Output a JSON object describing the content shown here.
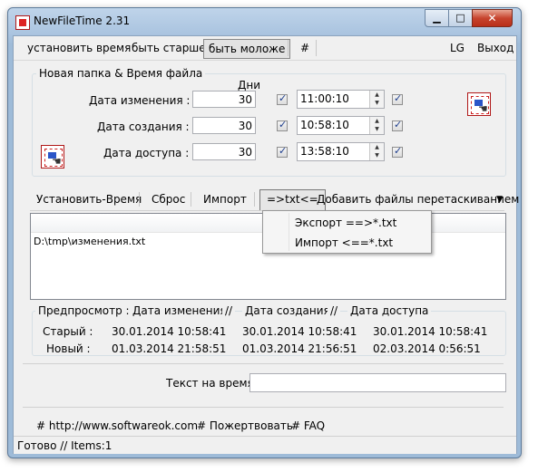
{
  "window": {
    "title": "NewFileTime 2.31"
  },
  "menu": {
    "set_time": "установить время",
    "older": "быть старше",
    "younger": "быть моложе",
    "hash": "#",
    "lg": "LG",
    "exit": "Выход"
  },
  "group": {
    "title": "Новая папка & Время файла",
    "days_header": "Дни",
    "rows": [
      {
        "label": "Дата изменения :",
        "days": "30",
        "time": "11:00:10"
      },
      {
        "label": "Дата создания :",
        "days": "30",
        "time": "10:58:10"
      },
      {
        "label": "Дата доступа :",
        "days": "30",
        "time": "13:58:10"
      }
    ]
  },
  "toolbar": {
    "set_time": "Установить-Время",
    "reset": "Сброс",
    "import": "Импорт",
    "txt": "=>txt<=",
    "add_files": "Добавить файлы перетаскиванием",
    "dropdown": "▼"
  },
  "txt_menu": {
    "export": "Экспорт ==>*.txt",
    "import": "Импорт <==*.txt"
  },
  "list": {
    "rows": [
      "D:\\tmp\\изменения.txt"
    ]
  },
  "preview": {
    "title": "Предпросмотр :",
    "col_mod": "Дата изменения",
    "sep1": "//",
    "col_create": "Дата создания",
    "sep2": "//",
    "col_access": "Дата доступа",
    "old_label": "Старый :",
    "new_label": "Новый :",
    "old": [
      "30.01.2014 10:58:41",
      "30.01.2014 10:58:41",
      "30.01.2014 10:58:41"
    ],
    "new": [
      "01.03.2014 21:58:51",
      "01.03.2014 21:56:51",
      "02.03.2014 0:56:51"
    ]
  },
  "text_time": {
    "label": "Текст на время",
    "value": ""
  },
  "links": {
    "website": "# http://www.softwareok.com",
    "donate": "# Пожертвовать",
    "faq": "# FAQ"
  },
  "status": {
    "text": "Готово // Items:1"
  }
}
